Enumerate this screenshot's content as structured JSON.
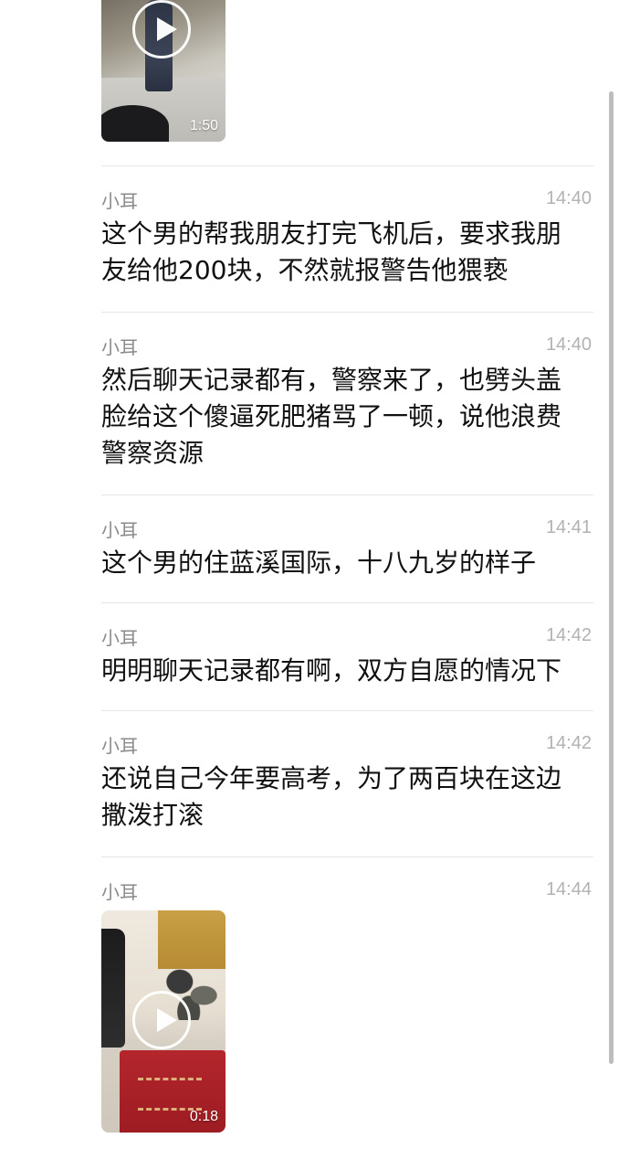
{
  "messages": [
    {
      "type": "video",
      "duration": "1:50"
    },
    {
      "type": "text",
      "sender": "小耳",
      "time": "14:40",
      "text": "这个男的帮我朋友打完飞机后，要求我朋友给他200块，不然就报警告他猥亵"
    },
    {
      "type": "text",
      "sender": "小耳",
      "time": "14:40",
      "text": "然后聊天记录都有，警察来了，也劈头盖脸给这个傻逼死肥猪骂了一顿，说他浪费警察资源"
    },
    {
      "type": "text",
      "sender": "小耳",
      "time": "14:41",
      "text": "这个男的住蓝溪国际，十八九岁的样子"
    },
    {
      "type": "text",
      "sender": "小耳",
      "time": "14:42",
      "text": "明明聊天记录都有啊，双方自愿的情况下"
    },
    {
      "type": "text",
      "sender": "小耳",
      "time": "14:42",
      "text": "还说自己今年要高考，为了两百块在这边撒泼打滚"
    },
    {
      "type": "video",
      "sender": "小耳",
      "time": "14:44",
      "duration": "0:18"
    }
  ],
  "icons": {
    "play": "play-icon"
  },
  "colors": {
    "sender": "#8b8b8b",
    "time": "#b2b2b2",
    "text": "#111111",
    "divider": "#e5e5e5"
  }
}
